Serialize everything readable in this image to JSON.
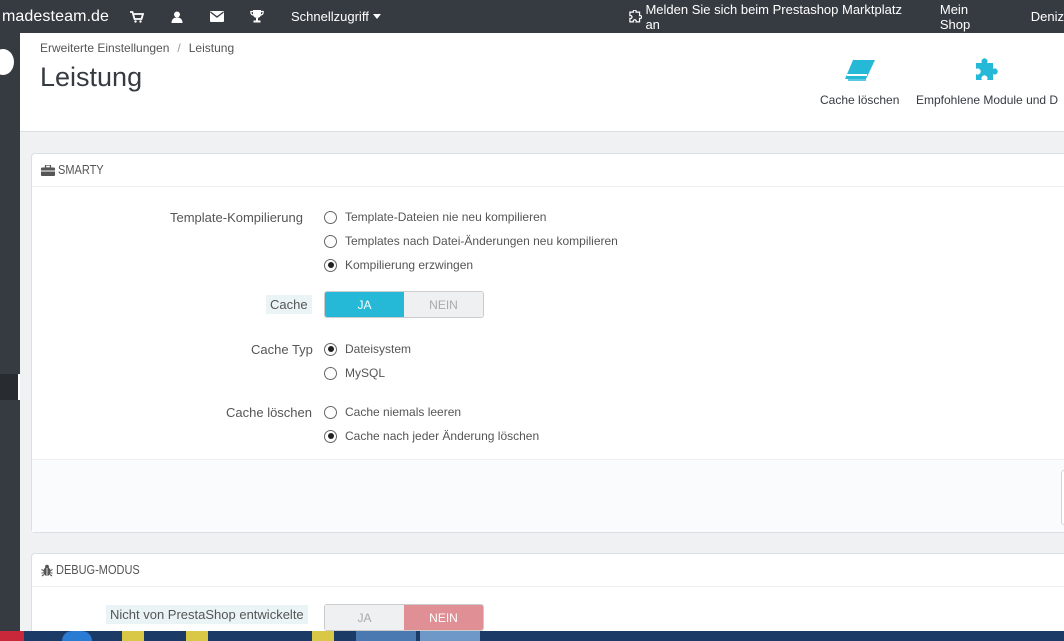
{
  "topbar": {
    "brand": "madesteam.de",
    "icons": [
      "cart-icon",
      "user-icon",
      "envelope-icon",
      "trophy-icon"
    ],
    "quick_access": "Schnellzugriff",
    "addons_login": "Melden Sie sich beim Prestashop Marktplatz an",
    "my_shop": "Mein Shop",
    "user": "Deniz"
  },
  "breadcrumb": {
    "parent": "Erweiterte Einstellungen",
    "separator": "/",
    "current": "Leistung"
  },
  "page_title": "Leistung",
  "toolbar": {
    "clear_cache": "Cache löschen",
    "recommended_modules": "Empfohlene Module und D"
  },
  "smarty": {
    "heading": "SMARTY",
    "template_compilation": {
      "label": "Template-Kompilierung",
      "options": [
        {
          "label": "Template-Dateien nie neu kompilieren",
          "checked": false
        },
        {
          "label": "Templates nach Datei-Änderungen neu kompilieren",
          "checked": false
        },
        {
          "label": "Kompilierung erzwingen",
          "checked": true
        }
      ]
    },
    "cache": {
      "label": "Cache",
      "yes": "JA",
      "no": "NEIN",
      "value": "JA"
    },
    "cache_type": {
      "label": "Cache Typ",
      "options": [
        {
          "label": "Dateisystem",
          "checked": true
        },
        {
          "label": "MySQL",
          "checked": false
        }
      ]
    },
    "clear_cache": {
      "label": "Cache löschen",
      "options": [
        {
          "label": "Cache niemals leeren",
          "checked": false
        },
        {
          "label": "Cache nach jeder Änderung löschen",
          "checked": true
        }
      ]
    }
  },
  "debug": {
    "heading": "DEBUG-MODUS",
    "non_prestashop": {
      "label": "Nicht von PrestaShop entwickelte",
      "yes": "JA",
      "no": "NEIN",
      "value": "NEIN"
    }
  },
  "colors": {
    "accent": "#25b9d7",
    "danger": "#e08f95",
    "topbar": "#363a41"
  }
}
